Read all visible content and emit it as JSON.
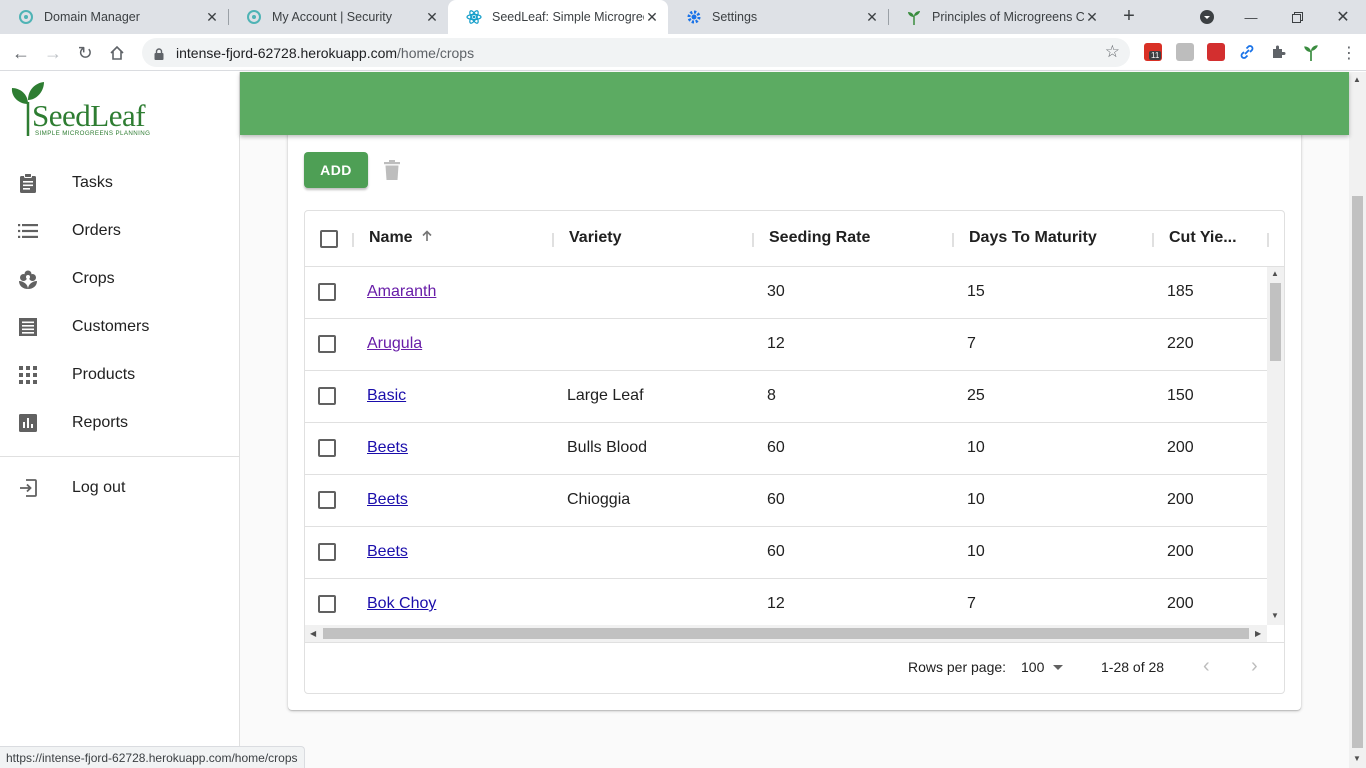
{
  "browser": {
    "tabs": [
      {
        "title": "Domain Manager",
        "icon": "domain-manager-icon"
      },
      {
        "title": "My Account | Security",
        "icon": "domain-manager-icon"
      },
      {
        "title": "SeedLeaf: Simple Microgreen",
        "icon": "react-icon"
      },
      {
        "title": "Settings",
        "icon": "gear-icon"
      },
      {
        "title": "Principles of Microgreens Cro",
        "icon": "sprout-icon"
      }
    ],
    "url_host": "intense-fjord-62728.herokuapp.com",
    "url_path": "/home/crops",
    "status_url": "https://intense-fjord-62728.herokuapp.com/home/crops",
    "calendar_badge": "11"
  },
  "logo": {
    "word": "SeedLeaf",
    "tagline": "SIMPLE MICROGREENS PLANNING"
  },
  "nav": {
    "tasks": "Tasks",
    "orders": "Orders",
    "crops": "Crops",
    "customers": "Customers",
    "products": "Products",
    "reports": "Reports",
    "logout": "Log out"
  },
  "toolbar": {
    "add_label": "ADD"
  },
  "grid": {
    "columns": {
      "name": "Name",
      "variety": "Variety",
      "seeding_rate": "Seeding Rate",
      "days_to_maturity": "Days To Maturity",
      "cut_yield": "Cut Yie..."
    },
    "rows": [
      {
        "name": "Amaranth",
        "variety": "",
        "seeding_rate": "30",
        "days": "15",
        "cut_yield": "185"
      },
      {
        "name": "Arugula",
        "variety": "",
        "seeding_rate": "12",
        "days": "7",
        "cut_yield": "220"
      },
      {
        "name": "Basic",
        "variety": "Large Leaf",
        "seeding_rate": "8",
        "days": "25",
        "cut_yield": "150"
      },
      {
        "name": "Beets",
        "variety": "Bulls Blood",
        "seeding_rate": "60",
        "days": "10",
        "cut_yield": "200"
      },
      {
        "name": "Beets",
        "variety": "Chioggia",
        "seeding_rate": "60",
        "days": "10",
        "cut_yield": "200"
      },
      {
        "name": "Beets",
        "variety": "",
        "seeding_rate": "60",
        "days": "10",
        "cut_yield": "200"
      },
      {
        "name": "Bok Choy",
        "variety": "",
        "seeding_rate": "12",
        "days": "7",
        "cut_yield": "200"
      }
    ],
    "footer": {
      "rows_per_page_label": "Rows per page:",
      "rows_per_page_value": "100",
      "range": "1-28 of 28"
    }
  },
  "colors": {
    "appbar": "#5cab62",
    "add_button": "#4e9f55",
    "link": "#1a0dab",
    "visited_link": "#681da8"
  }
}
